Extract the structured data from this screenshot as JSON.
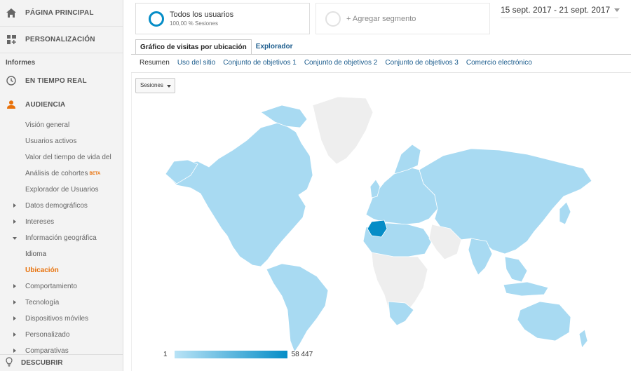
{
  "sidebar": {
    "home": "PÁGINA PRINCIPAL",
    "customize": "PERSONALIZACIÓN",
    "reports_title": "Informes",
    "realtime": "EN TIEMPO REAL",
    "audience": "AUDIENCIA",
    "items": [
      {
        "label": "Visión general"
      },
      {
        "label": "Usuarios activos"
      },
      {
        "label": "Valor del tiempo de vida del"
      },
      {
        "label": "Análisis de cohortes",
        "badge": "BETA"
      },
      {
        "label": "Explorador de Usuarios"
      },
      {
        "label": "Datos demográficos"
      },
      {
        "label": "Intereses"
      },
      {
        "label": "Información geográfica"
      },
      {
        "label": "Idioma"
      },
      {
        "label": "Ubicación"
      },
      {
        "label": "Comportamiento"
      },
      {
        "label": "Tecnología"
      },
      {
        "label": "Dispositivos móviles"
      },
      {
        "label": "Personalizado"
      },
      {
        "label": "Comparativas"
      }
    ],
    "discover": "DESCUBRIR"
  },
  "segments": {
    "active_title": "Todos los usuarios",
    "active_sub": "100,00 % Sesiones",
    "add": "+ Agregar segmento"
  },
  "date_range": "15 sept. 2017 - 21 sept. 2017",
  "tabs": [
    "Gráfico de visitas por ubicación",
    "Explorador"
  ],
  "subtabs": [
    "Resumen",
    "Uso del sitio",
    "Conjunto de objetivos 1",
    "Conjunto de objetivos 2",
    "Conjunto de objetivos 3",
    "Comercio electrónico"
  ],
  "metric_select": "Sesiones",
  "legend": {
    "min": "1",
    "max": "58 447"
  },
  "colors": {
    "accent": "#e8710a",
    "map_light": "#a8daf2",
    "map_dark": "#058dc7",
    "map_nodata": "#eeeeee",
    "link": "#1a5b8c"
  }
}
